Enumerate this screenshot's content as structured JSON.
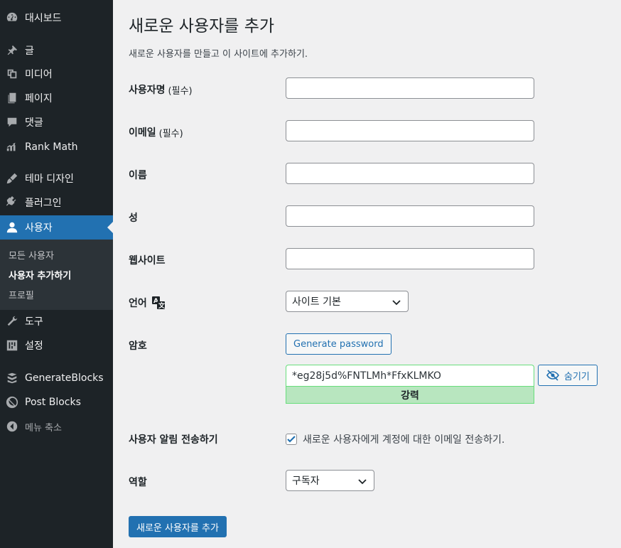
{
  "sidebar": {
    "items": [
      {
        "label": "대시보드",
        "icon": "dashboard-icon"
      },
      {
        "label": "글",
        "icon": "pin-icon"
      },
      {
        "label": "미디어",
        "icon": "media-icon"
      },
      {
        "label": "페이지",
        "icon": "page-icon"
      },
      {
        "label": "댓글",
        "icon": "comment-icon"
      },
      {
        "label": "Rank Math",
        "icon": "rank-math-icon"
      },
      {
        "label": "테마 디자인",
        "icon": "brush-icon"
      },
      {
        "label": "플러그인",
        "icon": "plugin-icon"
      },
      {
        "label": "사용자",
        "icon": "user-icon"
      },
      {
        "label": "도구",
        "icon": "wrench-icon"
      },
      {
        "label": "설정",
        "icon": "settings-icon"
      },
      {
        "label": "GenerateBlocks",
        "icon": "blocks-icon"
      },
      {
        "label": "Post Blocks",
        "icon": "post-blocks-icon"
      },
      {
        "label": "메뉴 축소",
        "icon": "collapse-icon"
      }
    ],
    "submenu": [
      {
        "label": "모든 사용자"
      },
      {
        "label": "사용자 추가하기"
      },
      {
        "label": "프로필"
      }
    ]
  },
  "page": {
    "title": "새로운 사용자를 추가",
    "description": "새로운 사용자를 만들고 이 사이트에 추가하기."
  },
  "form": {
    "username_label": "사용자명",
    "username_required": "(필수)",
    "email_label": "이메일",
    "email_required": "(필수)",
    "firstname_label": "이름",
    "lastname_label": "성",
    "website_label": "웹사이트",
    "language_label": "언어",
    "language_value": "사이트 기본",
    "password_label": "암호",
    "generate_password": "Generate password",
    "password_value": "*eg28j5d%FNTLMh*FfxKLMKO",
    "password_strength": "강력",
    "hide_button": "숨기기",
    "notify_label": "사용자 알림 전송하기",
    "notify_text": "새로운 사용자에게 계정에 대한 이메일 전송하기.",
    "role_label": "역할",
    "role_value": "구독자",
    "submit": "새로운 사용자를 추가"
  },
  "colors": {
    "sidebar_bg": "#1d2327",
    "accent": "#2271b1",
    "strength_bg": "#b8e6bf"
  }
}
